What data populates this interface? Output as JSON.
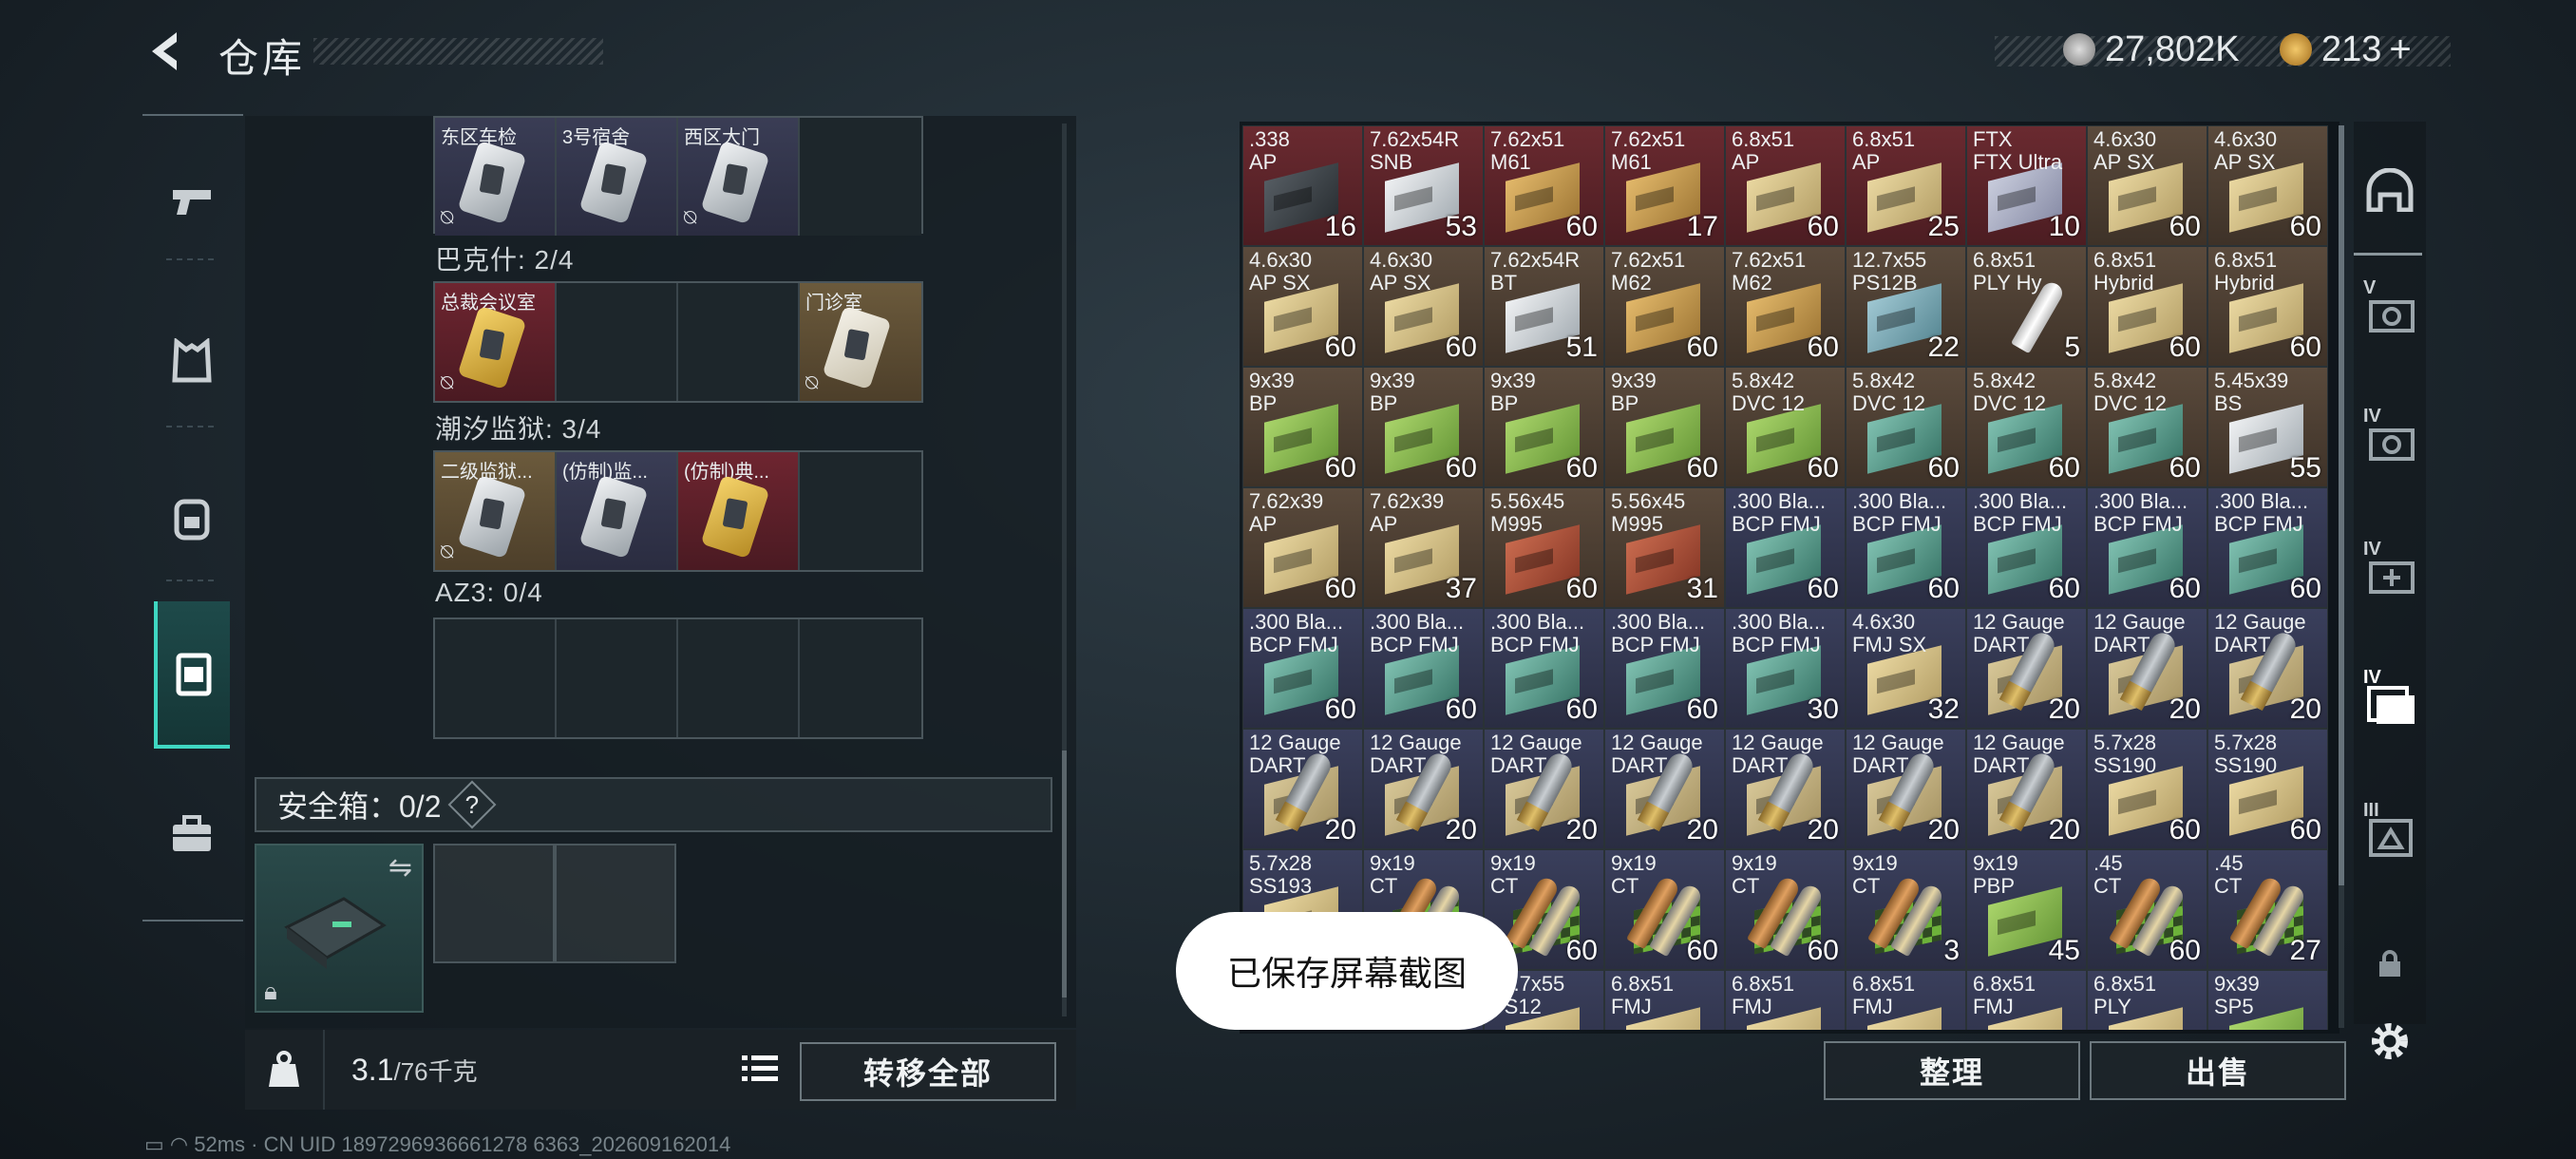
{
  "header": {
    "title": "仓库",
    "back_icon": "chevron-left-icon"
  },
  "currency": {
    "silver": "27,802K",
    "gold": "213",
    "add_label": "+"
  },
  "left_nav": [
    {
      "icon": "pistol-icon"
    },
    {
      "icon": "vest-icon"
    },
    {
      "icon": "backpack-icon"
    },
    {
      "icon": "container-icon"
    },
    {
      "icon": "briefcase-icon"
    }
  ],
  "keys_sections": [
    {
      "title": "",
      "slots": [
        {
          "name": "东区车检",
          "color": "blue",
          "card": "silver",
          "locked": true
        },
        {
          "name": "3号宿舍",
          "color": "blue",
          "card": "silver",
          "locked": false
        },
        {
          "name": "西区大门",
          "color": "blue",
          "card": "silver",
          "locked": true
        },
        {
          "name": "",
          "color": "",
          "card": "",
          "locked": false
        }
      ]
    },
    {
      "title": "巴克什: 2/4",
      "slots": [
        {
          "name": "总裁会议室",
          "color": "red",
          "card": "gold",
          "locked": true
        },
        {
          "name": "",
          "color": "",
          "card": "",
          "locked": false
        },
        {
          "name": "",
          "color": "",
          "card": "",
          "locked": false
        },
        {
          "name": "门诊室",
          "color": "gold",
          "card": "ivory",
          "locked": true
        }
      ]
    },
    {
      "title": "潮汐监狱: 3/4",
      "slots": [
        {
          "name": "二级监狱...",
          "color": "gold",
          "card": "silver",
          "locked": true
        },
        {
          "name": "(仿制)监...",
          "color": "blue",
          "card": "silver",
          "locked": false
        },
        {
          "name": "(仿制)典...",
          "color": "red",
          "card": "gold",
          "locked": false
        },
        {
          "name": "",
          "color": "",
          "card": "",
          "locked": false
        }
      ]
    },
    {
      "title": "AZ3: 0/4",
      "slots": [
        {
          "name": "",
          "color": "",
          "card": "",
          "locked": false
        },
        {
          "name": "",
          "color": "",
          "card": "",
          "locked": false
        },
        {
          "name": "",
          "color": "",
          "card": "",
          "locked": false
        },
        {
          "name": "",
          "color": "",
          "card": "",
          "locked": false
        }
      ]
    }
  ],
  "safe_box": {
    "label": "安全箱：0/2",
    "help": "?"
  },
  "weight": {
    "current": "3.1",
    "max": "/76千克",
    "icon": "kg-weight-icon"
  },
  "buttons": {
    "transfer_all": "转移全部",
    "organize": "整理",
    "sell": "出售"
  },
  "toast": "已保存屏幕截图",
  "status_bar": "52ms · CN UID 1897296936661278 6363_202609162014",
  "ammo": [
    {
      "name": ".338\nAP",
      "qty": "16",
      "color": "red",
      "art": "dark"
    },
    {
      "name": "7.62x54R\nSNB",
      "qty": "53",
      "color": "red",
      "art": "gray"
    },
    {
      "name": "7.62x51\nM61",
      "qty": "60",
      "color": "red",
      "art": "tan"
    },
    {
      "name": "7.62x51\nM61",
      "qty": "17",
      "color": "red",
      "art": "tan"
    },
    {
      "name": "6.8x51\nAP",
      "qty": "60",
      "color": "red",
      "art": "cream"
    },
    {
      "name": "6.8x51\nAP",
      "qty": "25",
      "color": "red",
      "art": "cream"
    },
    {
      "name": "FTX\nFTX Ultra",
      "qty": "10",
      "color": "red",
      "art": "lav"
    },
    {
      "name": "4.6x30\nAP SX",
      "qty": "60",
      "color": "brown",
      "art": "cream"
    },
    {
      "name": "4.6x30\nAP SX",
      "qty": "60",
      "color": "brown",
      "art": "cream"
    },
    {
      "name": "4.6x30\nAP SX",
      "qty": "60",
      "color": "brown",
      "art": "cream"
    },
    {
      "name": "4.6x30\nAP SX",
      "qty": "60",
      "color": "brown",
      "art": "cream"
    },
    {
      "name": "7.62x54R\nBT",
      "qty": "51",
      "color": "brown",
      "art": "gray"
    },
    {
      "name": "7.62x51\nM62",
      "qty": "60",
      "color": "brown",
      "art": "tan"
    },
    {
      "name": "7.62x51\nM62",
      "qty": "60",
      "color": "brown",
      "art": "tan"
    },
    {
      "name": "12.7x55\nPS12B",
      "qty": "22",
      "color": "brown",
      "art": "steel"
    },
    {
      "name": "6.8x51\nPLY Hy",
      "qty": "5",
      "color": "brown",
      "art": "white"
    },
    {
      "name": "6.8x51\nHybrid",
      "qty": "60",
      "color": "brown",
      "art": "cream"
    },
    {
      "name": "6.8x51\nHybrid",
      "qty": "60",
      "color": "brown",
      "art": "cream"
    },
    {
      "name": "9x39\nBP",
      "qty": "60",
      "color": "brown",
      "art": "lime"
    },
    {
      "name": "9x39\nBP",
      "qty": "60",
      "color": "brown",
      "art": "lime"
    },
    {
      "name": "9x39\nBP",
      "qty": "60",
      "color": "brown",
      "art": "lime"
    },
    {
      "name": "9x39\nBP",
      "qty": "60",
      "color": "brown",
      "art": "lime"
    },
    {
      "name": "5.8x42\nDVC 12",
      "qty": "60",
      "color": "brown",
      "art": "lime"
    },
    {
      "name": "5.8x42\nDVC 12",
      "qty": "60",
      "color": "brown",
      "art": "teal"
    },
    {
      "name": "5.8x42\nDVC 12",
      "qty": "60",
      "color": "brown",
      "art": "teal"
    },
    {
      "name": "5.8x42\nDVC 12",
      "qty": "60",
      "color": "brown",
      "art": "teal"
    },
    {
      "name": "5.45x39\nBS",
      "qty": "55",
      "color": "brown",
      "art": "gray"
    },
    {
      "name": "7.62x39\nAP",
      "qty": "60",
      "color": "brown",
      "art": "cream"
    },
    {
      "name": "7.62x39\nAP",
      "qty": "37",
      "color": "brown",
      "art": "cream"
    },
    {
      "name": "5.56x45\nM995",
      "qty": "60",
      "color": "brown",
      "art": "rust"
    },
    {
      "name": "5.56x45\nM995",
      "qty": "31",
      "color": "brown",
      "art": "rust"
    },
    {
      "name": ".300 Bla...\nBCP FMJ",
      "qty": "60",
      "color": "blue",
      "art": "teal"
    },
    {
      "name": ".300 Bla...\nBCP FMJ",
      "qty": "60",
      "color": "blue",
      "art": "teal"
    },
    {
      "name": ".300 Bla...\nBCP FMJ",
      "qty": "60",
      "color": "blue",
      "art": "teal"
    },
    {
      "name": ".300 Bla...\nBCP FMJ",
      "qty": "60",
      "color": "blue",
      "art": "teal"
    },
    {
      "name": ".300 Bla...\nBCP FMJ",
      "qty": "60",
      "color": "blue",
      "art": "teal"
    },
    {
      "name": ".300 Bla...\nBCP FMJ",
      "qty": "60",
      "color": "blue",
      "art": "teal"
    },
    {
      "name": ".300 Bla...\nBCP FMJ",
      "qty": "60",
      "color": "blue",
      "art": "teal"
    },
    {
      "name": ".300 Bla...\nBCP FMJ",
      "qty": "60",
      "color": "blue",
      "art": "teal"
    },
    {
      "name": ".300 Bla...\nBCP FMJ",
      "qty": "60",
      "color": "blue",
      "art": "teal"
    },
    {
      "name": ".300 Bla...\nBCP FMJ",
      "qty": "30",
      "color": "blue",
      "art": "teal"
    },
    {
      "name": "4.6x30\nFMJ SX",
      "qty": "32",
      "color": "blue",
      "art": "cream"
    },
    {
      "name": "12 Gauge\nDART",
      "qty": "20",
      "color": "blue",
      "art": "shell"
    },
    {
      "name": "12 Gauge\nDART",
      "qty": "20",
      "color": "blue",
      "art": "shell"
    },
    {
      "name": "12 Gauge\nDART",
      "qty": "20",
      "color": "blue",
      "art": "shell"
    },
    {
      "name": "12 Gauge\nDART",
      "qty": "20",
      "color": "blue",
      "art": "shell"
    },
    {
      "name": "12 Gauge\nDART",
      "qty": "20",
      "color": "blue",
      "art": "shell"
    },
    {
      "name": "12 Gauge\nDART",
      "qty": "20",
      "color": "blue",
      "art": "shell"
    },
    {
      "name": "12 Gauge\nDART",
      "qty": "20",
      "color": "blue",
      "art": "shell"
    },
    {
      "name": "12 Gauge\nDART",
      "qty": "20",
      "color": "blue",
      "art": "shell"
    },
    {
      "name": "12 Gauge\nDART",
      "qty": "20",
      "color": "blue",
      "art": "shell"
    },
    {
      "name": "12 Gauge\nDART",
      "qty": "20",
      "color": "blue",
      "art": "shell"
    },
    {
      "name": "5.7x28\nSS190",
      "qty": "60",
      "color": "blue",
      "art": "cream"
    },
    {
      "name": "5.7x28\nSS190",
      "qty": "60",
      "color": "blue",
      "art": "cream"
    },
    {
      "name": "5.7x28\nSS193",
      "qty": "",
      "color": "blue",
      "art": "cream"
    },
    {
      "name": "9x19\nCT",
      "qty": "",
      "color": "blue",
      "art": "bullet"
    },
    {
      "name": "9x19\nCT",
      "qty": "60",
      "color": "blue",
      "art": "bullet"
    },
    {
      "name": "9x19\nCT",
      "qty": "60",
      "color": "blue",
      "art": "bullet"
    },
    {
      "name": "9x19\nCT",
      "qty": "60",
      "color": "blue",
      "art": "bullet"
    },
    {
      "name": "9x19\nCT",
      "qty": "3",
      "color": "blue",
      "art": "bullet"
    },
    {
      "name": "9x19\nPBP",
      "qty": "45",
      "color": "blue",
      "art": "lime"
    },
    {
      "name": ".45\nCT",
      "qty": "60",
      "color": "blue",
      "art": "bullet"
    },
    {
      "name": ".45\nCT",
      "qty": "27",
      "color": "blue",
      "art": "bullet"
    },
    {
      "name": "12.7x55\nPS12",
      "qty": "",
      "color": "blue",
      "art": "cream"
    },
    {
      "name": "12.7x55\nPS12",
      "qty": "",
      "color": "blue",
      "art": "cream"
    },
    {
      "name": "12.7x55\nPS12",
      "qty": "",
      "color": "blue",
      "art": "cream"
    },
    {
      "name": "6.8x51\nFMJ",
      "qty": "",
      "color": "blue",
      "art": "cream"
    },
    {
      "name": "6.8x51\nFMJ",
      "qty": "",
      "color": "blue",
      "art": "cream"
    },
    {
      "name": "6.8x51\nFMJ",
      "qty": "",
      "color": "blue",
      "art": "cream"
    },
    {
      "name": "6.8x51\nFMJ",
      "qty": "",
      "color": "blue",
      "art": "cream"
    },
    {
      "name": "6.8x51\nPLY",
      "qty": "",
      "color": "blue",
      "art": "cream"
    },
    {
      "name": "9x39\nSP5",
      "qty": "",
      "color": "blue",
      "art": "lime"
    }
  ],
  "right_tabs": [
    {
      "level": "",
      "icon": "helmet-icon"
    },
    {
      "level": "V",
      "icon": "armor-chest-icon"
    },
    {
      "level": "IV",
      "icon": "armor-rig-icon"
    },
    {
      "level": "IV",
      "icon": "medkit-icon"
    },
    {
      "level": "IV",
      "icon": "key-storage-icon"
    },
    {
      "level": "III",
      "icon": "map-icon"
    },
    {
      "level": "",
      "icon": "lock-icon"
    }
  ]
}
